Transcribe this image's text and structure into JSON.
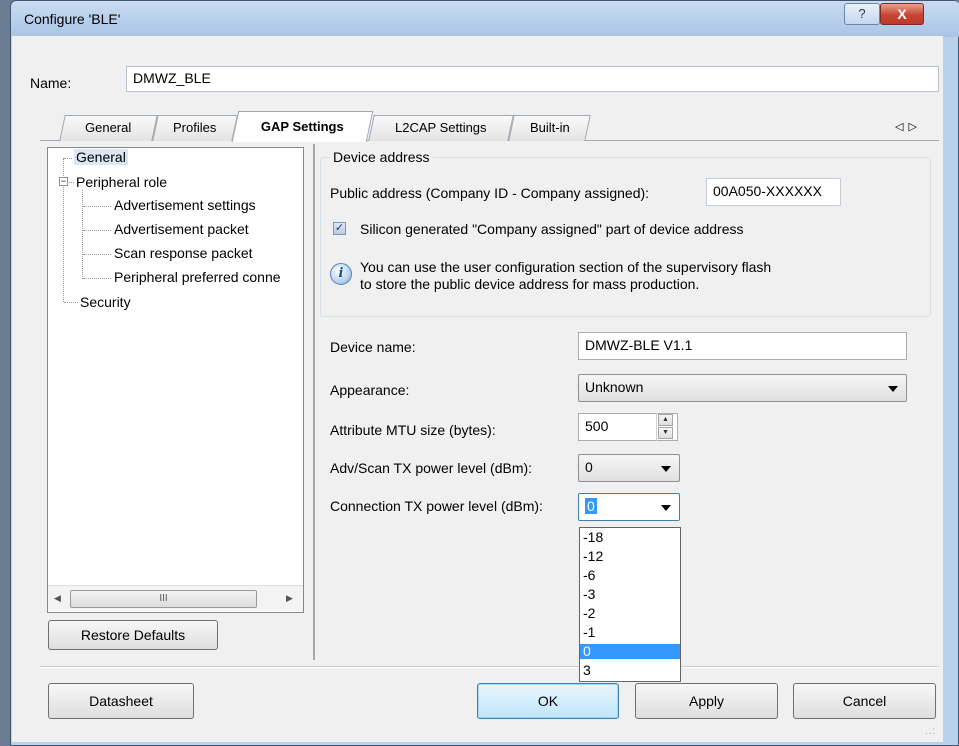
{
  "window": {
    "title": "Configure 'BLE'",
    "help_glyph": "?",
    "close_glyph": "X"
  },
  "name_row": {
    "label": "Name:",
    "value": "DMWZ_BLE"
  },
  "tabs": {
    "items": [
      "General",
      "Profiles",
      "GAP Settings",
      "L2CAP Settings",
      "Built-in"
    ],
    "active": "GAP Settings",
    "scroll_glyph": "◁▷"
  },
  "tree": {
    "items": [
      {
        "label": "General",
        "selected": true
      },
      {
        "label": "Peripheral role",
        "expander": "−"
      },
      {
        "label": "Advertisement settings"
      },
      {
        "label": "Advertisement packet"
      },
      {
        "label": "Scan response packet"
      },
      {
        "label": "Peripheral preferred conne"
      },
      {
        "label": "Security"
      }
    ],
    "hscroll_left": "◀",
    "hscroll_thumb": "III",
    "hscroll_right": "▶"
  },
  "restore_defaults_label": "Restore Defaults",
  "device_address": {
    "group_title": "Device address",
    "public_address_label": "Public address (Company ID - Company assigned):",
    "public_address_value": "00A050-XXXXXX",
    "silicon_checkbox_label": "Silicon generated \"Company assigned\" part of device address",
    "silicon_checked": true,
    "info_icon_glyph": "i",
    "info_line1": "You can use the user configuration section of the supervisory flash",
    "info_line2": "to store the public device address for mass production."
  },
  "fields": {
    "device_name_label": "Device name:",
    "device_name_value": "DMWZ-BLE V1.1",
    "appearance_label": "Appearance:",
    "appearance_value": "Unknown",
    "mtu_label": "Attribute MTU size (bytes):",
    "mtu_value": "500",
    "spin_up": "▲",
    "spin_down": "▼",
    "adv_tx_label": "Adv/Scan TX power level (dBm):",
    "adv_tx_value": "0",
    "conn_tx_label": "Connection TX power level (dBm):",
    "conn_tx_value": "0"
  },
  "conn_tx_dropdown": {
    "options": [
      "-18",
      "-12",
      "-6",
      "-3",
      "-2",
      "-1",
      "0",
      "3"
    ],
    "selected": "0"
  },
  "buttons": {
    "datasheet": "Datasheet",
    "ok": "OK",
    "apply": "Apply",
    "cancel": "Cancel"
  },
  "size_grip_glyph": "..:"
}
